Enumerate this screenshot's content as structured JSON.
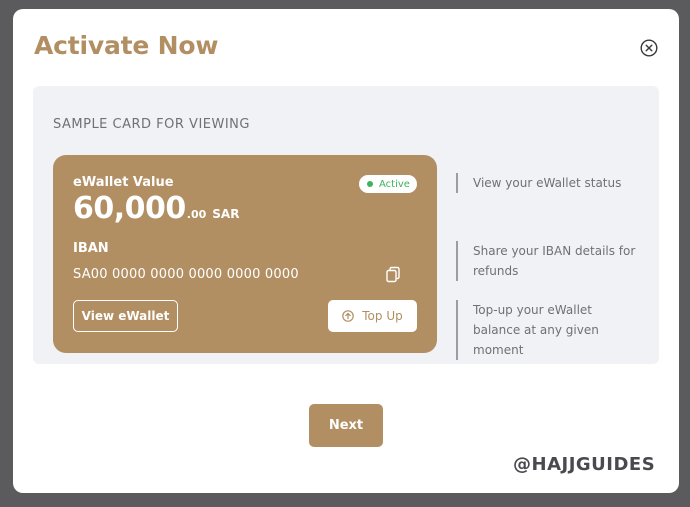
{
  "modal": {
    "title": "Activate Now",
    "close_icon": "close-circle-icon",
    "accent_color": "#b28f63"
  },
  "panel": {
    "label": "SAMPLE CARD FOR VIEWING"
  },
  "card": {
    "title": "eWallet Value",
    "status": "Active",
    "status_color": "#3fb35b",
    "amount_integer": "60,000",
    "amount_decimal": ".00",
    "currency": "SAR",
    "iban_label": "IBAN",
    "iban_number": "SA00 0000 0000 0000 0000 0000",
    "copy_icon": "copy-icon",
    "view_button": "View eWallet",
    "topup_button": "Top Up",
    "topup_icon": "arrow-up-circle-icon"
  },
  "features": [
    "View your eWallet status",
    "Share your IBAN details for refunds",
    "Top-up your eWallet balance at any given moment"
  ],
  "next_button": "Next",
  "watermark": "@HAJJGUIDES"
}
